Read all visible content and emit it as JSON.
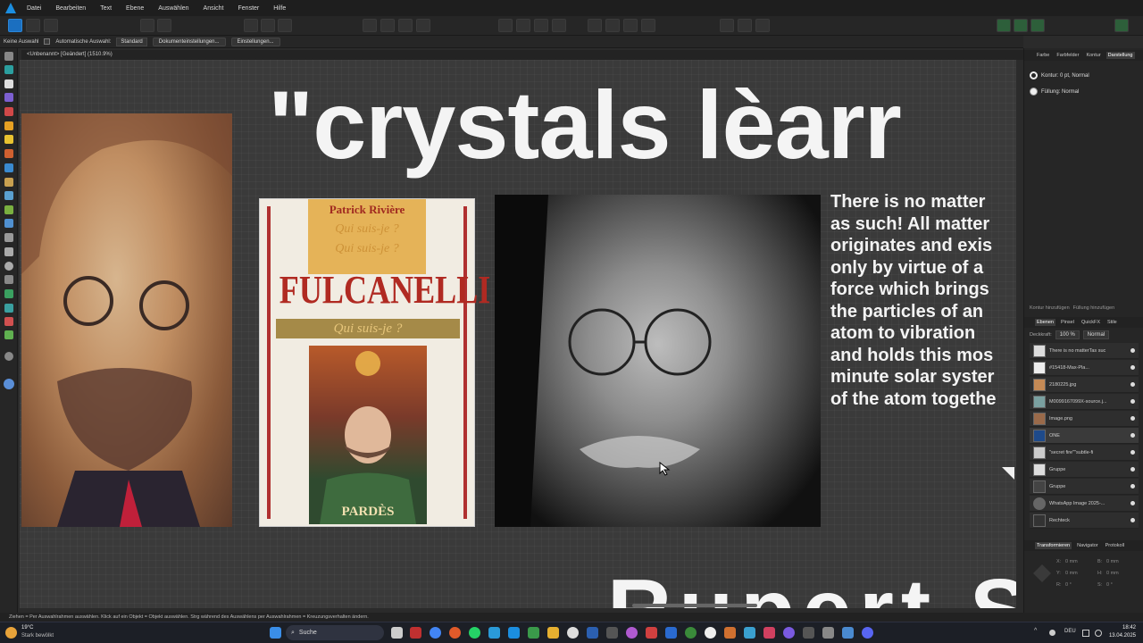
{
  "menubar": {
    "items": [
      "Datei",
      "Bearbeiten",
      "Text",
      "Ebene",
      "Auswählen",
      "Ansicht",
      "Fenster",
      "Hilfe"
    ]
  },
  "contextbar": {
    "selection": "Keine Auswahl",
    "auto_select": "Automatische Auswahl:",
    "mode": "Standard",
    "doc_settings": "Dokumenteinstellungen...",
    "settings": "Einstellungen..."
  },
  "document": {
    "tab_title": "<Unbenannt> [Geändert] (1510.9%)"
  },
  "canvas": {
    "headline": "\"crystals lèarr",
    "bottom_word": "Rupert S",
    "book": {
      "author": "Patrick Rivière",
      "series": "Qui suis-je ?",
      "title": "FULCANELLI",
      "publisher": "PARDÈS"
    },
    "quote": "There is no matter\nas such! All matter\noriginates and exis\nonly by virtue of a\nforce which brings\nthe particles of an\natom to vibration\nand holds this mos\nminute solar syster\nof the atom togethe"
  },
  "right_panel": {
    "tabs_top": [
      "Farbe",
      "Farbfelder",
      "Kontur",
      "Darstellung"
    ],
    "stroke": "Kontur: 0 pt,  Normal",
    "fill": "Füllung:  Normal",
    "add_stroke": "Kontur hinzufügen",
    "add_fill": "Füllung hinzufügen",
    "tabs_layers": [
      "Ebenen",
      "Pinsel",
      "QuickFX",
      "Stile"
    ],
    "opacity_label": "Deckkraft:",
    "opacity": "100 %",
    "blend": "Normal",
    "layers": [
      "There is no matterTas suc",
      "#15418-Max-Pla...",
      "2180225.jpg",
      "M0099167099X-source.j...",
      "Image.png",
      "ONE",
      "\"secret fire\"\"subtle-fi",
      "Gruppe",
      "Gruppe",
      "WhatsApp Image 2025-...",
      "Rechteck"
    ],
    "tabs_transform": [
      "Transformieren",
      "Navigator",
      "Protokoll"
    ],
    "transform_fields": [
      "X:",
      "0 mm",
      "B:",
      "0 mm",
      "Y:",
      "0 mm",
      "H:",
      "0 mm",
      "R:",
      "0 °",
      "S:",
      "0 °"
    ]
  },
  "statusbar": {
    "text": "Ziehen = Per Auswahlrahmen auswählen. Klick auf ein Objekt = Objekt auswählen. Strg während des Auswählens per Auswahlrahmen = Kreuzungsverhalten ändern."
  },
  "taskbar": {
    "weather_temp": "19°C",
    "weather_desc": "Stark bewölkt",
    "search": "Suche",
    "lang": "DEU",
    "time": "18:42",
    "date": "13.04.2025"
  },
  "colors": {
    "accent": "#1b6fc0",
    "canvas": "#3a3a3a",
    "panel": "#262626"
  }
}
